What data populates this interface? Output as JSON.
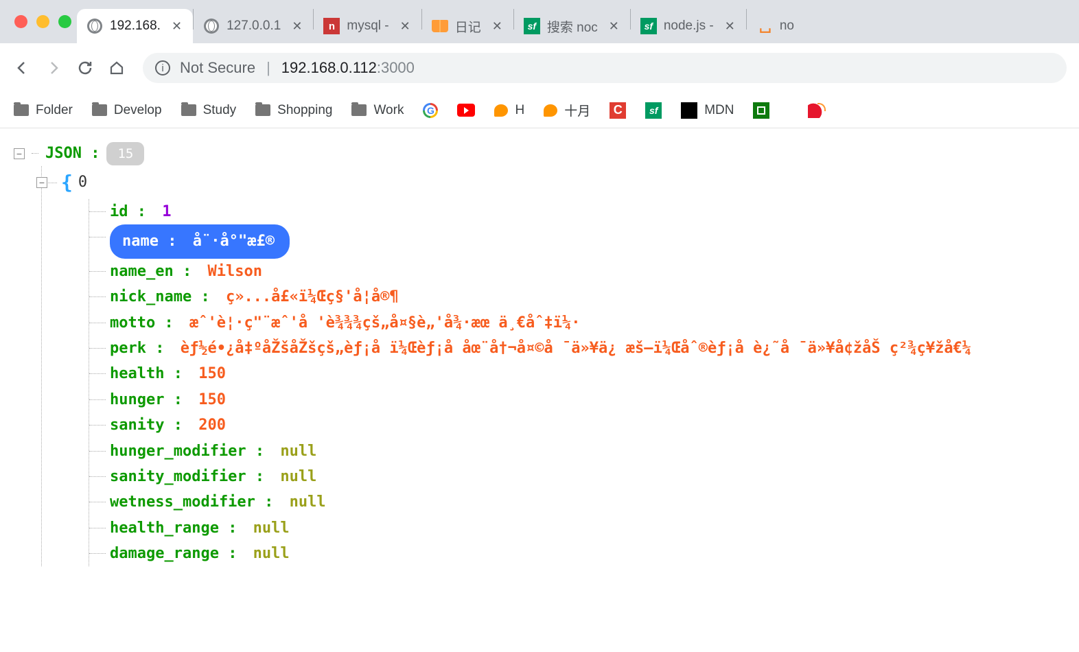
{
  "tabs": [
    {
      "title": "192.168.",
      "type": "globe",
      "active": true
    },
    {
      "title": "127.0.0.1",
      "type": "globe",
      "active": false
    },
    {
      "title": "mysql - ",
      "type": "npm",
      "active": false
    },
    {
      "title": "日记",
      "type": "book",
      "active": false
    },
    {
      "title": "搜索 noc",
      "type": "sf",
      "active": false
    },
    {
      "title": "node.js -",
      "type": "sf",
      "active": false
    },
    {
      "title": "no",
      "type": "so",
      "active": false
    }
  ],
  "omnibox": {
    "not_secure": "Not Secure",
    "host": "192.168.0.112",
    "port": ":3000"
  },
  "bookmarks": [
    {
      "label": "Folder",
      "icon": "folder"
    },
    {
      "label": "Develop",
      "icon": "folder"
    },
    {
      "label": "Study",
      "icon": "folder"
    },
    {
      "label": "Shopping",
      "icon": "folder"
    },
    {
      "label": "Work",
      "icon": "folder"
    },
    {
      "label": "",
      "icon": "google"
    },
    {
      "label": "",
      "icon": "youtube"
    },
    {
      "label": "H",
      "icon": "blob"
    },
    {
      "label": "十月",
      "icon": "blob"
    },
    {
      "label": "",
      "icon": "c"
    },
    {
      "label": "",
      "icon": "sf"
    },
    {
      "label": "MDN",
      "icon": "dino"
    },
    {
      "label": "",
      "icon": "douban"
    },
    {
      "label": "",
      "icon": "apple"
    },
    {
      "label": "",
      "icon": "weibo"
    }
  ],
  "json_viewer": {
    "root_label": "JSON :",
    "root_count": "15",
    "array_index": "0",
    "fields": [
      {
        "key": "id",
        "value": "1",
        "type": "num",
        "highlighted": false
      },
      {
        "key": "name",
        "value": "å¨·å°\"æ£®",
        "type": "str",
        "highlighted": true
      },
      {
        "key": "name_en",
        "value": "Wilson",
        "type": "str",
        "highlighted": false
      },
      {
        "key": "nick_name",
        "value": "ç»...å£«ï¼Œç§'å¦å®¶",
        "type": "str",
        "highlighted": false
      },
      {
        "key": "motto",
        "value": "æˆ'è¦·ç\"¨æˆ'å   'è¾¾¾çš„å¤§è„'å¾·æœ   ä¸€åˆ‡ï¼·",
        "type": "str",
        "highlighted": false
      },
      {
        "key": "perk",
        "value": "èƒ½é•¿å‡ºåŽšåŽšçš„èƒ¡å   ï¼Œèƒ¡å   åœ¨å†¬å¤©å   ¯ä»¥ä¿   æš–ï¼Œåˆ®èƒ¡å   è¿˜å   ¯ä»¥å¢žåŠ ç²¾ç¥žå€¼",
        "type": "str",
        "highlighted": false
      },
      {
        "key": "health",
        "value": "150",
        "type": "str",
        "highlighted": false
      },
      {
        "key": "hunger",
        "value": "150",
        "type": "str",
        "highlighted": false
      },
      {
        "key": "sanity",
        "value": "200",
        "type": "str",
        "highlighted": false
      },
      {
        "key": "hunger_modifier",
        "value": "null",
        "type": "null",
        "highlighted": false
      },
      {
        "key": "sanity_modifier",
        "value": "null",
        "type": "null",
        "highlighted": false
      },
      {
        "key": "wetness_modifier",
        "value": "null",
        "type": "null",
        "highlighted": false
      },
      {
        "key": "health_range",
        "value": "null",
        "type": "null",
        "highlighted": false
      },
      {
        "key": "damage_range",
        "value": "null",
        "type": "null",
        "highlighted": false
      }
    ]
  }
}
